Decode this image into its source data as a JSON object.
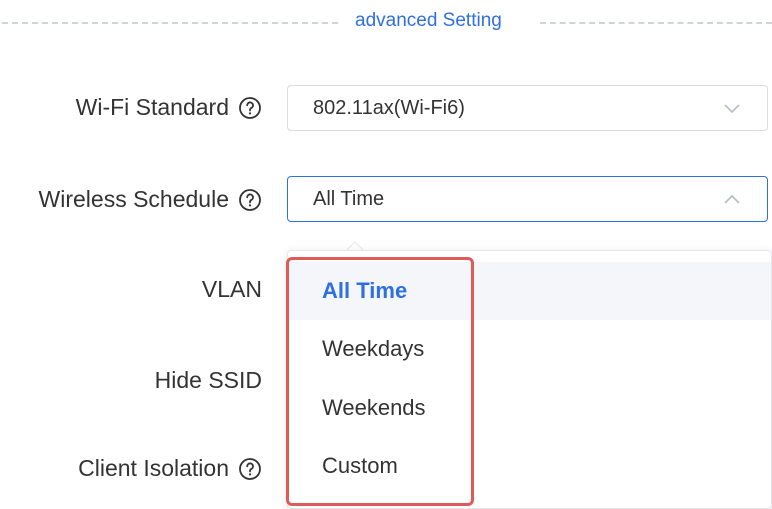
{
  "section": {
    "title": "advanced Setting"
  },
  "fields": {
    "wifi_standard": {
      "label": "Wi-Fi Standard",
      "value": "802.11ax(Wi-Fi6)"
    },
    "wireless_schedule": {
      "label": "Wireless Schedule",
      "value": "All Time"
    },
    "vlan": {
      "label": "VLAN"
    },
    "hide_ssid": {
      "label": "Hide SSID"
    },
    "client_isolation": {
      "label": "Client Isolation"
    }
  },
  "dropdown": {
    "options": [
      "All Time",
      "Weekdays",
      "Weekends",
      "Custom"
    ],
    "selected": "All Time"
  },
  "colors": {
    "accent": "#2f6fe4",
    "highlight_border": "#e05a5a",
    "text": "#333333"
  },
  "icons": {
    "help": "question-circle-icon",
    "chevron_down": "chevron-down-icon",
    "chevron_up": "chevron-up-icon"
  }
}
